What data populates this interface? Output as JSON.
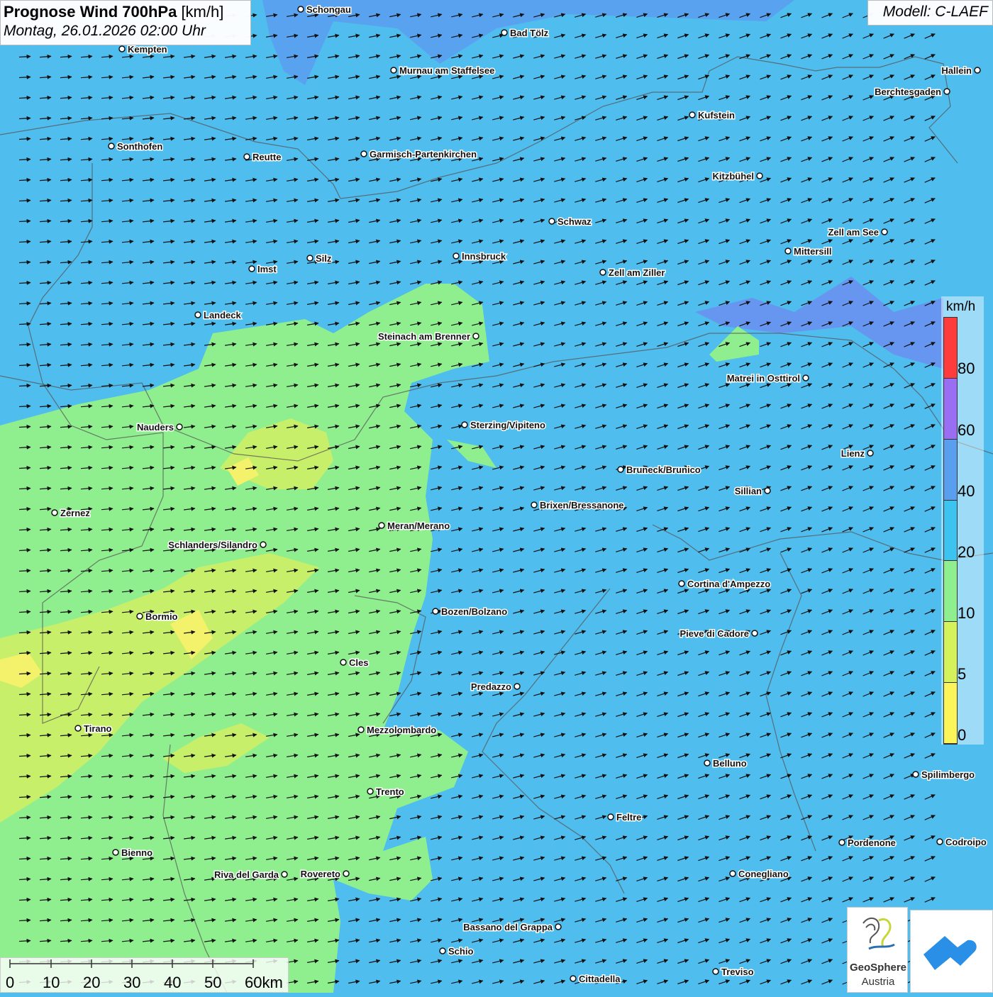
{
  "header": {
    "title_main": "Prognose Wind 700hPa",
    "title_unit": "[km/h]",
    "datetime": "Montag, 26.01.2026 02:00 Uhr",
    "model": "Modell: C-LAEF"
  },
  "legend": {
    "unit": "km/h",
    "labels": [
      "80",
      "60",
      "40",
      "20",
      "10",
      "5",
      "0"
    ],
    "colors": [
      "#ff3b3b",
      "#9a6ef2",
      "#5a9ef0",
      "#3dc3f0",
      "#8fef8f",
      "#d6f25a",
      "#fbf55a"
    ]
  },
  "scale_bar": {
    "labels": [
      "0",
      "10",
      "20",
      "30",
      "40",
      "50",
      "60km"
    ]
  },
  "logo": {
    "name": "GeoSphere",
    "sub": "Austria",
    "icon": "geosphere-logo-icon"
  },
  "app_icon": "cloud-app-icon",
  "wind": {
    "direction": "west-southwest",
    "icon": "wind-arrow-icon"
  },
  "cities": [
    {
      "name": "Schongau"
    },
    {
      "name": "Bad Tölz"
    },
    {
      "name": "Kempten"
    },
    {
      "name": "Murnau am Staffelsee"
    },
    {
      "name": "Hallein"
    },
    {
      "name": "Berchtesgaden"
    },
    {
      "name": "Kufstein"
    },
    {
      "name": "Sonthofen"
    },
    {
      "name": "Reutte"
    },
    {
      "name": "Garmisch-Partenkirchen"
    },
    {
      "name": "Kitzbühel"
    },
    {
      "name": "Schwaz"
    },
    {
      "name": "Zell am See"
    },
    {
      "name": "Mittersill"
    },
    {
      "name": "Innsbruck"
    },
    {
      "name": "Silz"
    },
    {
      "name": "Imst"
    },
    {
      "name": "Zell am Ziller"
    },
    {
      "name": "Landeck"
    },
    {
      "name": "Steinach am Brenner"
    },
    {
      "name": "Matrei in Osttirol"
    },
    {
      "name": "Nauders"
    },
    {
      "name": "Sterzing/Vipiteno"
    },
    {
      "name": "Lienz"
    },
    {
      "name": "Bruneck/Brunico"
    },
    {
      "name": "Sillian"
    },
    {
      "name": "Brixen/Bressanone"
    },
    {
      "name": "Zernez"
    },
    {
      "name": "Meran/Merano"
    },
    {
      "name": "Schlanders/Silandro"
    },
    {
      "name": "Cortina d'Ampezzo"
    },
    {
      "name": "Bozen/Bolzano"
    },
    {
      "name": "Bormio"
    },
    {
      "name": "Pieve di Cadore"
    },
    {
      "name": "Cles"
    },
    {
      "name": "Predazzo"
    },
    {
      "name": "Tirano"
    },
    {
      "name": "Mezzolombardo"
    },
    {
      "name": "Belluno"
    },
    {
      "name": "Spilimbergo"
    },
    {
      "name": "Trento"
    },
    {
      "name": "Feltre"
    },
    {
      "name": "Pordenone"
    },
    {
      "name": "Codroipo"
    },
    {
      "name": "Bienno"
    },
    {
      "name": "Riva del Garda"
    },
    {
      "name": "Rovereto"
    },
    {
      "name": "Conegliano"
    },
    {
      "name": "Bassano del Grappa"
    },
    {
      "name": "Schio"
    },
    {
      "name": "Treviso"
    },
    {
      "name": "Cittadella"
    }
  ]
}
